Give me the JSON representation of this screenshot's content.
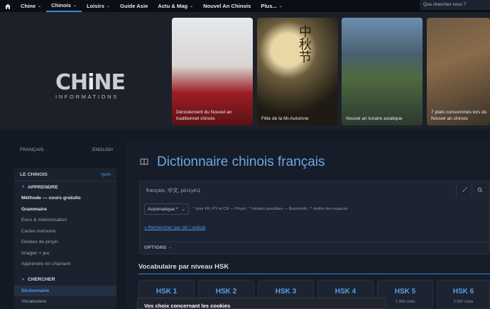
{
  "nav": {
    "items": [
      {
        "label": "Chine",
        "caret": "⌄"
      },
      {
        "label": "Chinois",
        "caret": "⌄"
      },
      {
        "label": "Loisirs",
        "caret": "⌄"
      },
      {
        "label": "Guide Asie",
        "caret": ""
      },
      {
        "label": "Actu & Mag",
        "caret": "⌄"
      },
      {
        "label": "Nouvel An Chinois",
        "caret": ""
      },
      {
        "label": "Plus...",
        "caret": "⌄"
      }
    ],
    "search_placeholder": "Que cherchez vous ?"
  },
  "logo": {
    "main_a": "CH",
    "main_b": "i",
    "main_c": "NE",
    "sub": "INFORMATIONS"
  },
  "cards": [
    {
      "caption": "Déroulement du Nouvel an traditionnel chinois"
    },
    {
      "caption": "Fête de la Mi-Automne",
      "chars": "中秋节"
    },
    {
      "caption": "Nouvel an lunaire asiatique"
    },
    {
      "caption": "7 plats consommés lors du Nouvel an chinois"
    }
  ],
  "sidebar": {
    "lang_fr": "FRANÇAIS",
    "lang_en": "ENGLISH",
    "header": "LE CHINOIS",
    "header_pinyin": "+pAn",
    "section_learn": "APPRENDRE",
    "learn_items": [
      "Méthode — cours gratuits",
      "Grammaire",
      "Exos & mémorisation",
      "Cartes mémoire",
      "Dictées de pinyin",
      "Imagier + jeu",
      "Apprendre en chantant"
    ],
    "section_search": "CHERCHER",
    "search_items": [
      "Dictionnaire",
      "Vocabulaire"
    ]
  },
  "dictionary": {
    "title": "Dictionnaire chinois français",
    "search_placeholder": "français, 中文, pin1yin1",
    "mode": "Automatique *",
    "hint": "* pour FR, PY et CN — Pinyin : * initiales possibles — Bopomofo : * mettre des espaces",
    "radical_link": "» Rechercher par clé / radical",
    "options_label": "OPTIONS →"
  },
  "hsk": {
    "title": "Vocabulaire par niveau HSK",
    "levels": [
      {
        "label": "HSK 1",
        "words": ""
      },
      {
        "label": "HSK 2",
        "words": ""
      },
      {
        "label": "HSK 3",
        "words": ""
      },
      {
        "label": "HSK 4",
        "words": ""
      },
      {
        "label": "HSK 5",
        "words": "1 356 mots"
      },
      {
        "label": "HSK 6",
        "words": "2 597 mots"
      }
    ]
  },
  "cookie": {
    "title": "Vos choix concernant les cookies"
  }
}
